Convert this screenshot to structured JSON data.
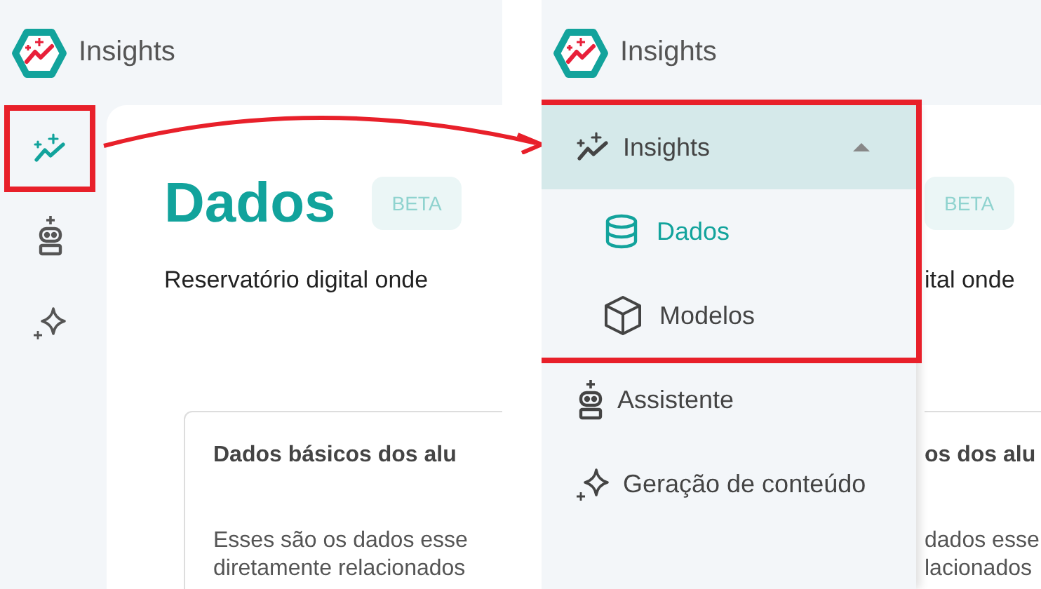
{
  "left_panel": {
    "header": {
      "title": "Insights"
    },
    "sidebar_icons": [
      {
        "kind": "insights",
        "selected": true,
        "highlighted": true
      },
      {
        "kind": "assistant",
        "selected": false,
        "highlighted": false
      },
      {
        "kind": "sparkle",
        "selected": false,
        "highlighted": false
      }
    ],
    "page": {
      "title": "Dados",
      "badge": "BETA",
      "description": "Reservatório digital onde",
      "card": {
        "title": "Dados básicos dos alu",
        "text_lines": [
          "Esses são os dados esse",
          "diretamente relacionados"
        ]
      }
    }
  },
  "right_panel": {
    "header": {
      "title": "Insights"
    },
    "menu": [
      {
        "kind": "insights",
        "label": "Insights",
        "expanded": true,
        "highlighted": true,
        "children": [
          {
            "kind": "database",
            "label": "Dados",
            "selected": true
          },
          {
            "kind": "cube",
            "label": "Modelos",
            "selected": false
          }
        ]
      },
      {
        "kind": "assistant",
        "label": "Assistente",
        "expanded": false,
        "highlighted": false
      },
      {
        "kind": "sparkle",
        "label": "Geração de conteúdo",
        "expanded": false,
        "highlighted": false
      }
    ],
    "page": {
      "badge": "BETA",
      "description": "ital onde",
      "card": {
        "title": "os dos alu",
        "text_lines": [
          "dados esse",
          "lacionados"
        ]
      }
    }
  }
}
